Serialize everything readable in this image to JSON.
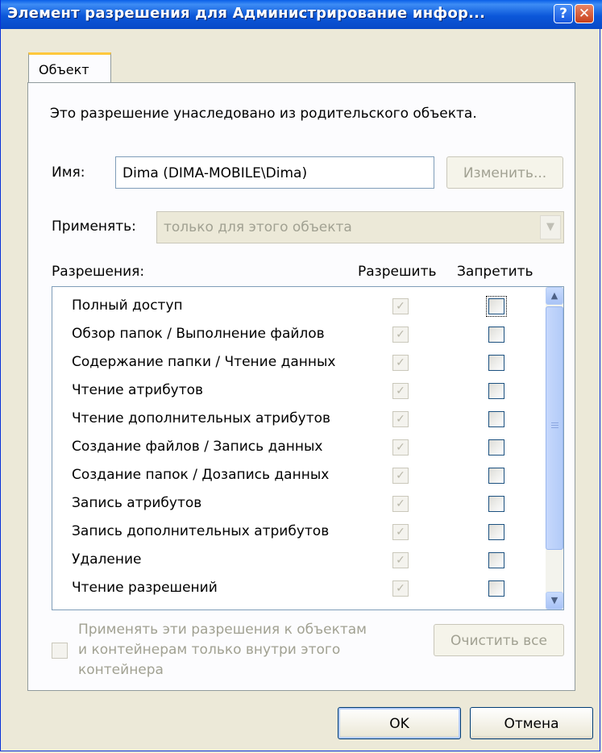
{
  "window": {
    "title": "Элемент разрешения для Администрирование инфор...",
    "help_label": "?",
    "close_label": "✕"
  },
  "tab": {
    "label": "Объект"
  },
  "info_text": "Это разрешение унаследовано из родительского объекта.",
  "name": {
    "label": "Имя:",
    "value": "Dima (DIMA-MOBILE\\Dima)",
    "change_button": "Изменить..."
  },
  "apply_to": {
    "label": "Применять:",
    "value": "только для этого объекта"
  },
  "permissions": {
    "label": "Разрешения:",
    "allow_header": "Разрешить",
    "deny_header": "Запретить",
    "rows": [
      {
        "label": "Полный доступ",
        "allow": true,
        "deny": false
      },
      {
        "label": "Обзор папок / Выполнение файлов",
        "allow": true,
        "deny": false
      },
      {
        "label": "Содержание папки / Чтение данных",
        "allow": true,
        "deny": false
      },
      {
        "label": "Чтение атрибутов",
        "allow": true,
        "deny": false
      },
      {
        "label": "Чтение дополнительных атрибутов",
        "allow": true,
        "deny": false
      },
      {
        "label": "Создание файлов / Запись данных",
        "allow": true,
        "deny": false
      },
      {
        "label": "Создание папок / Дозапись данных",
        "allow": true,
        "deny": false
      },
      {
        "label": "Запись атрибутов",
        "allow": true,
        "deny": false
      },
      {
        "label": "Запись дополнительных атрибутов",
        "allow": true,
        "deny": false
      },
      {
        "label": "Удаление",
        "allow": true,
        "deny": false
      },
      {
        "label": "Чтение разрешений",
        "allow": true,
        "deny": false
      }
    ]
  },
  "inherit": {
    "line1": "Применять эти разрешения к объектам",
    "line2": "и контейнерам только внутри этого",
    "line3": "контейнера"
  },
  "clear_all_button": "Очистить все",
  "ok_button": "OK",
  "cancel_button": "Отмена"
}
